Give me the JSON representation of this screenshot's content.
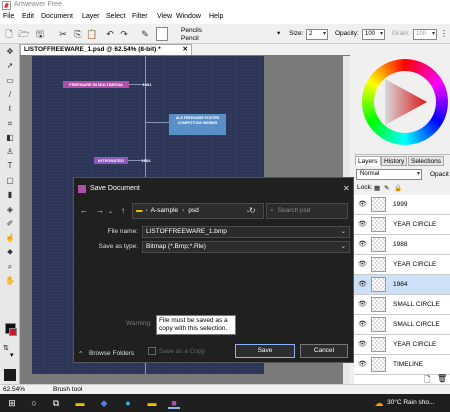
{
  "app": {
    "title": "Artweaver Free"
  },
  "menu": [
    "File",
    "Edit",
    "Document",
    "Layer",
    "Select",
    "Filter",
    "View",
    "Window",
    "Help"
  ],
  "toolbar": {
    "brush_category": "Pencils",
    "brush_variant": "Pencil",
    "size_label": "Size:",
    "size_value": "2",
    "opacity_label": "Opacity:",
    "opacity_value": "100",
    "grain_label": "Grain:",
    "grain_value": "100"
  },
  "document": {
    "tab_title": "LISTOFFREEWARE_1.psd @ 62.54% (8-bit) *",
    "timeline_labels": [
      "FREEWARE IN MULTIMEDIA",
      "1981",
      "ALE FREEWARE POSTER COMPETITION WINNER",
      "INTEGRATED",
      "1984"
    ]
  },
  "panels": {
    "tabs": [
      "Layers",
      "History",
      "Selections"
    ],
    "blend_mode": "Normal",
    "opacity_label": "Opacit",
    "lock_label": "Lock:",
    "layers": [
      "1999",
      "YEAR CIRCLE",
      "1988",
      "YEAR CIRCLE",
      "1984",
      "SMALL CIRCLE",
      "SMALL CIRCLE",
      "YEAR CIRCLE",
      "TIMELINE"
    ]
  },
  "status": {
    "zoom": "62.54%",
    "tool": "Brush tool"
  },
  "dialog": {
    "title": "Save Document",
    "breadcrumb_root": "A-sample",
    "breadcrumb_sep": "›",
    "breadcrumb_folder": "psd",
    "search_placeholder": "Search psd",
    "filename_label": "File name:",
    "filename_value": "LISTOFFREEWARE_1.bmp",
    "savetype_label": "Save as type:",
    "savetype_value": "Bitmap (*.Bmp;*.Rle)",
    "warning_label": "Warning:",
    "warning_text": "File must be saved as a copy with this selection.",
    "browse_label": "Browse Folders",
    "save_copy_label": "Save as a Copy",
    "save_button": "Save",
    "cancel_button": "Cancel"
  },
  "taskbar": {
    "weather": "30°C  Rain sho..."
  },
  "colors": {
    "dialog_bg": "#202020",
    "canvas_bg": "#2e3657",
    "accent": "#0078d7",
    "selected_layer": "#cce0f7"
  }
}
